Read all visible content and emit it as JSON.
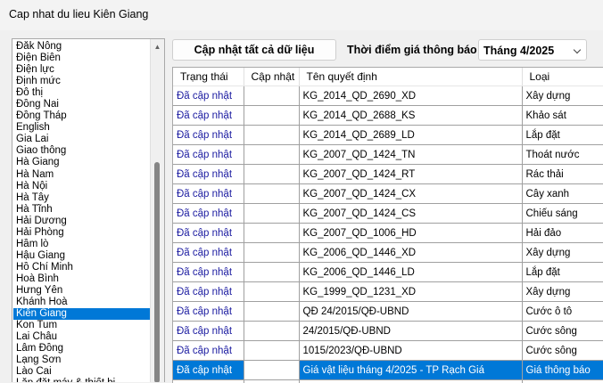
{
  "window": {
    "title": "Cap nhat du lieu Kiên Giang"
  },
  "provinces": {
    "items": [
      "Đăk Nông",
      "Điện Biên",
      "Điện lực",
      "Định mức",
      "Đô thị",
      "Đồng Nai",
      "Đồng Tháp",
      "English",
      "Gia Lai",
      "Giao thông",
      "Hà Giang",
      "Hà Nam",
      "Hà Nội",
      "Hà Tây",
      "Hà Tĩnh",
      "Hải Dương",
      "Hải Phòng",
      "Hầm lò",
      "Hậu Giang",
      "Hồ Chí Minh",
      "Hoà Bình",
      "Hưng Yên",
      "Khánh Hoà",
      "Kiên Giang",
      "Kon Tum",
      "Lai Châu",
      "Lâm Đồng",
      "Lạng Sơn",
      "Lào Cai",
      "Lắp đặt máy & thiết bị"
    ],
    "selected": "Kiên Giang"
  },
  "toolbar": {
    "update_all_label": "Cập nhật tất cả dữ liệu",
    "time_label": "Thời điểm giá thông báo",
    "time_value": "Tháng 4/2025"
  },
  "grid": {
    "columns": [
      "Trạng thái",
      "Cập nhật",
      "Tên quyết định",
      "Loại"
    ],
    "rows": [
      {
        "status": "Đã cập nhật",
        "check": "",
        "name": "KG_2014_QD_2690_XD",
        "type": "Xây dựng"
      },
      {
        "status": "Đã cập nhật",
        "check": "",
        "name": "KG_2014_QD_2688_KS",
        "type": "Khảo sát"
      },
      {
        "status": "Đã cập nhật",
        "check": "",
        "name": "KG_2014_QD_2689_LD",
        "type": "Lắp đặt"
      },
      {
        "status": "Đã cập nhật",
        "check": "",
        "name": "KG_2007_QD_1424_TN",
        "type": "Thoát nước"
      },
      {
        "status": "Đã cập nhật",
        "check": "",
        "name": "KG_2007_QD_1424_RT",
        "type": "Rác thải"
      },
      {
        "status": "Đã cập nhật",
        "check": "",
        "name": "KG_2007_QD_1424_CX",
        "type": "Cây xanh"
      },
      {
        "status": "Đã cập nhật",
        "check": "",
        "name": "KG_2007_QD_1424_CS",
        "type": "Chiếu sáng"
      },
      {
        "status": "Đã cập nhật",
        "check": "",
        "name": "KG_2007_QD_1006_HD",
        "type": "Hải đảo"
      },
      {
        "status": "Đã cập nhật",
        "check": "",
        "name": "KG_2006_QD_1446_XD",
        "type": "Xây dựng"
      },
      {
        "status": "Đã cập nhật",
        "check": "",
        "name": "KG_2006_QD_1446_LD",
        "type": "Lắp đặt"
      },
      {
        "status": "Đã cập nhật",
        "check": "",
        "name": "KG_1999_QD_1231_XD",
        "type": "Xây dựng"
      },
      {
        "status": "Đã cập nhật",
        "check": "",
        "name": "QĐ 24/2015/QĐ-UBND",
        "type": "Cước ô tô"
      },
      {
        "status": "Đã cập nhật",
        "check": "",
        "name": "24/2015/QĐ-UBND",
        "type": "Cước sông"
      },
      {
        "status": "Đã cập nhật",
        "check": "",
        "name": "1015/2023/QĐ-UBND",
        "type": "Cước sông"
      },
      {
        "status": "Đã cập nhật",
        "check": "",
        "name": "Giá vật liệu tháng 4/2025 - TP Rạch Giá",
        "type": "Giá thông báo",
        "selected": true
      },
      {
        "status": "",
        "check": "",
        "name": "",
        "type": ""
      }
    ]
  }
}
